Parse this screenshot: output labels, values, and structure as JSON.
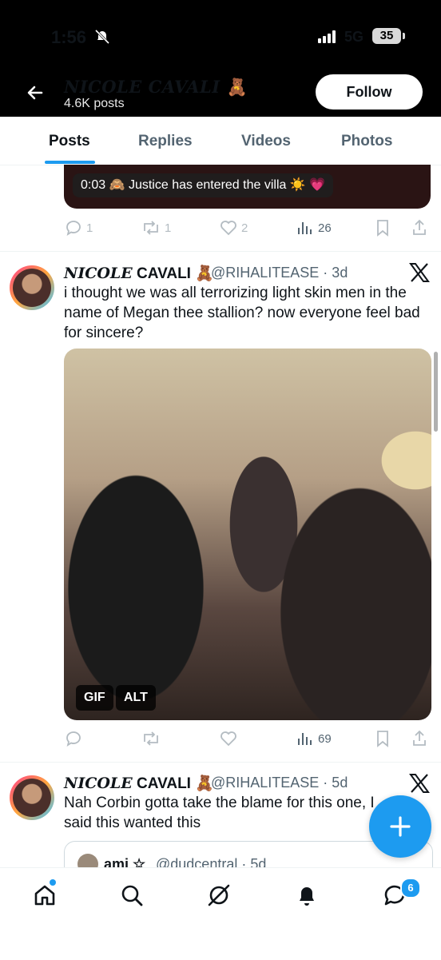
{
  "status_bar": {
    "time": "1:56",
    "network": "5G",
    "battery": "35"
  },
  "header": {
    "name": "NICOLE CAVALI",
    "name_emoji": "🧸",
    "posts_count": "4.6K posts",
    "follow_label": "Follow"
  },
  "tabs": [
    {
      "label": "Posts",
      "active": true
    },
    {
      "label": "Replies"
    },
    {
      "label": "Videos"
    },
    {
      "label": "Photos"
    }
  ],
  "prev_tweet": {
    "caption": "0:03  🙈 Justice has entered the villa ☀️ 💗",
    "replies": "1",
    "reposts": "1",
    "likes": "2",
    "views": "26"
  },
  "tweet1": {
    "name_serif": "NICOLE",
    "name_rest": " CAVALI 🧸",
    "handle": "@RIHALITEASE · 3d",
    "text": "i thought we was all terrorizing light skin men in the name of Megan thee stallion? now everyone feel bad for sincere?",
    "badge_gif": "GIF",
    "badge_alt": "ALT",
    "views": "69"
  },
  "tweet2": {
    "name_serif": "NICOLE",
    "name_rest": " CAVALI 🧸",
    "handle": "@RIHALITEASE · 5d",
    "text": "Nah Corbin gotta take the blame for this one, I said this wanted this",
    "quote_author": "ami ☆",
    "quote_handle": "@dudcentral · 5d"
  },
  "bottom_nav": {
    "messages_badge": "6"
  },
  "colors": {
    "accent": "#1d9bf0",
    "header_bg": "#000000"
  }
}
